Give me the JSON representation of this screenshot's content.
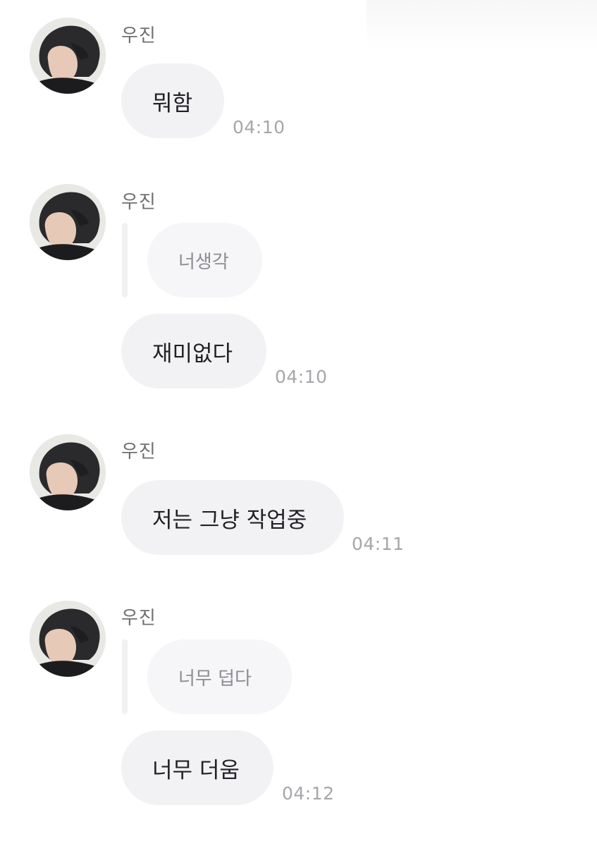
{
  "messages": [
    {
      "sender": "우진",
      "avatar_icon": "profile-photo-avatar",
      "text": "뭐함",
      "time": "04:10"
    },
    {
      "sender": "우진",
      "avatar_icon": "profile-photo-avatar",
      "reply_to": "너생각",
      "text": "재미없다",
      "time": "04:10"
    },
    {
      "sender": "우진",
      "avatar_icon": "profile-photo-avatar",
      "text": "저는 그냥 작업중",
      "time": "04:11"
    },
    {
      "sender": "우진",
      "avatar_icon": "profile-photo-avatar",
      "reply_to": "너무 덥다",
      "text": "너무 더움",
      "time": "04:12"
    }
  ],
  "colors": {
    "bubble_bg": "#f2f2f5",
    "reply_bg": "#f6f6f8",
    "sender_text": "#6f6f74",
    "time_text": "#a6a6ab",
    "message_text": "#222226"
  }
}
